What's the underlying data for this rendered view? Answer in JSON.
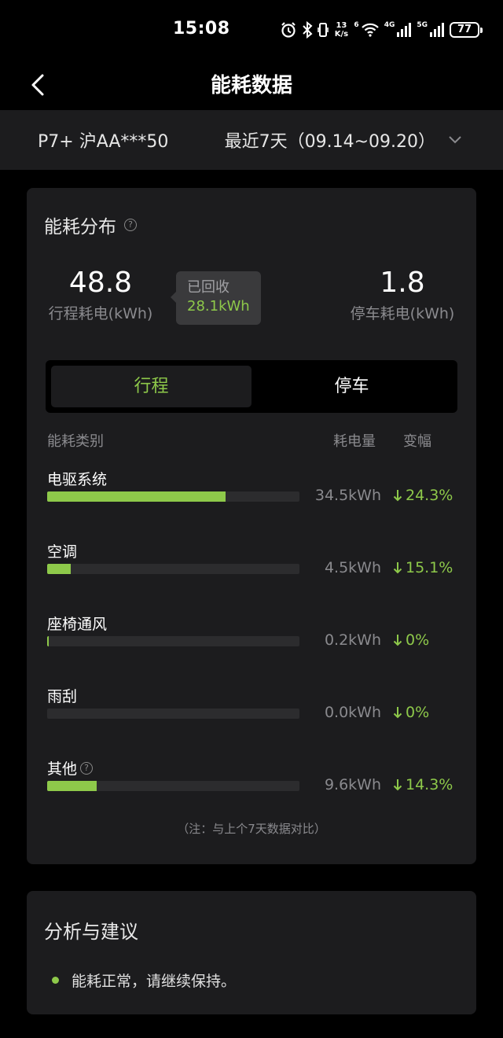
{
  "status_bar": {
    "time": "15:08",
    "net_speed_value": "13",
    "net_speed_unit": "K/s",
    "wifi_tag": "6",
    "sim1_tag": "4G",
    "sim2_tag": "5G",
    "battery": "77",
    "icons": [
      "alarm-icon",
      "bluetooth-icon",
      "vibrate-icon",
      "wifi-icon",
      "signal-icon",
      "signal-icon",
      "battery-icon"
    ]
  },
  "nav": {
    "title": "能耗数据"
  },
  "vehicle": {
    "name": "P7+ 沪AA***50",
    "date_range": "最近7天（09.14~09.20）"
  },
  "energy": {
    "title": "能耗分布",
    "drive_value": "48.8",
    "drive_label": "行程耗电(kWh)",
    "recover_label": "已回收",
    "recover_value": "28.1kWh",
    "park_value": "1.8",
    "park_label": "停车耗电(kWh)",
    "tabs": [
      "行程",
      "停车"
    ],
    "active_tab": 0,
    "headers": {
      "category": "能耗类别",
      "amount": "耗电量",
      "change": "变幅"
    },
    "rows": [
      {
        "label": "电驱系统",
        "amount": "34.5kWh",
        "change": "24.3%",
        "share": 0.707,
        "has_help": false
      },
      {
        "label": "空调",
        "amount": "4.5kWh",
        "change": "15.1%",
        "share": 0.092,
        "has_help": false
      },
      {
        "label": "座椅通风",
        "amount": "0.2kWh",
        "change": "0%",
        "share": 0.004,
        "has_help": false
      },
      {
        "label": "雨刮",
        "amount": "0.0kWh",
        "change": "0%",
        "share": 0.0,
        "has_help": false
      },
      {
        "label": "其他",
        "amount": "9.6kWh",
        "change": "14.3%",
        "share": 0.197,
        "has_help": true
      }
    ],
    "note": "（注：与上个7天数据对比）"
  },
  "advice": {
    "title": "分析与建议",
    "items": [
      "能耗正常，请继续保持。"
    ]
  },
  "colors": {
    "accent": "#8ec94a",
    "card_bg": "#1c1c1e",
    "track": "#2c2c2e",
    "muted_text": "#8a8a8e"
  }
}
